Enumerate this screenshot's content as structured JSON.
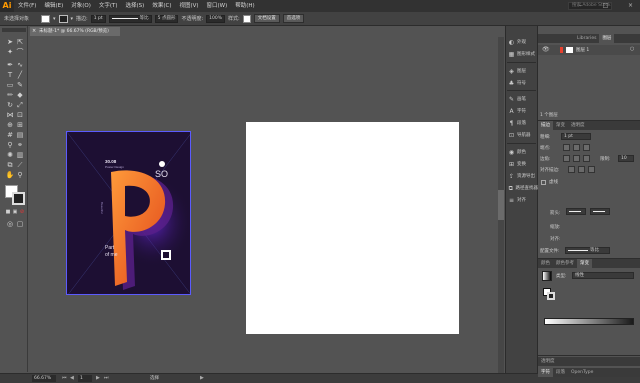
{
  "menubar": {
    "logo": "Ai",
    "items": [
      "文件(F)",
      "编辑(E)",
      "对象(O)",
      "文字(T)",
      "选择(S)",
      "效果(C)",
      "视图(V)",
      "窗口(W)",
      "帮助(H)"
    ],
    "search_placeholder": "搜索 Adobe Stock",
    "window_controls": [
      "–",
      "□",
      "×"
    ]
  },
  "controlbar": {
    "selection_label": "未选择对象",
    "stroke_label": "描边:",
    "stroke_weight": "1 pt",
    "stroke_profile": "等比",
    "brush": "5 点圆形",
    "opacity_label": "不透明度:",
    "opacity_value": "100%",
    "style_label": "样式:",
    "doc_setup_button": "文档设置",
    "preferences_button": "首选项"
  },
  "document_tab": {
    "title": "未标题-1* @ 66.67% (RGB/预览)",
    "close": "×"
  },
  "poster": {
    "date": "30.08",
    "subtitle": "Poster Design",
    "big_text": "SO",
    "vertical_text": "Beautiful",
    "caption_line1": "Part",
    "caption_line2": "of me",
    "colors": {
      "background": "#1d0f33",
      "accent": "#ff6a1a",
      "glow": "#7a2cff"
    }
  },
  "dock": {
    "items": [
      "外观",
      "图形样式",
      "图层",
      "符号",
      "画笔",
      "字符",
      "段落",
      "导航器",
      "颜色",
      "变换",
      "资源导出",
      "路径查找器",
      "对齐"
    ]
  },
  "layers_panel": {
    "tabs": [
      "Libraries",
      "图层"
    ],
    "layer_name": "图层 1",
    "footer": "1 个图层"
  },
  "stroke_panel": {
    "tabs": [
      "描边",
      "渐变",
      "透明度"
    ],
    "weight_label": "粗细:",
    "weight_value": "1 pt",
    "cap_label": "端点:",
    "corner_label": "边角:",
    "limit_label": "限制:",
    "limit_value": "10",
    "align_label": "对齐描边:",
    "dashed_label": "虚线",
    "arrow_label": "箭头:",
    "scale_label": "缩放:",
    "align_arrow_label": "对齐:",
    "profile_label": "配置文件:",
    "profile_value": "等比"
  },
  "gradient_panel": {
    "tabs": [
      "颜色",
      "颜色参考",
      "渐变"
    ],
    "type_label": "类型:",
    "type_value": "线性"
  },
  "bottom_panels": {
    "tabs_a": [
      "透明度"
    ],
    "tabs_b": [
      "字符",
      "段落",
      "OpenType"
    ]
  },
  "statusbar": {
    "zoom": "66.67%",
    "artboard_num": "1",
    "tool_name": "选择"
  }
}
